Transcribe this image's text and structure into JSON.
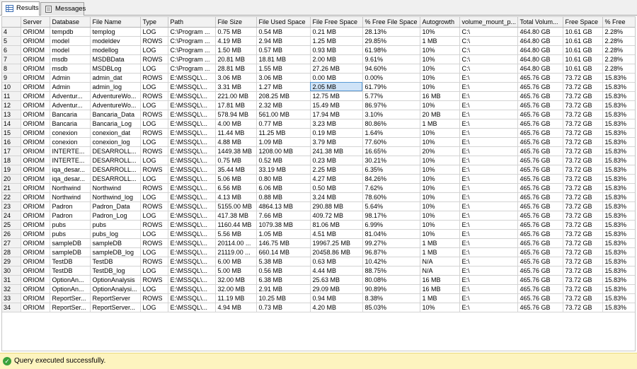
{
  "tabs": [
    {
      "label": "Results",
      "icon": "grid-icon"
    },
    {
      "label": "Messages",
      "icon": "document-icon"
    }
  ],
  "columns": [
    "",
    "Server",
    "Database",
    "File Name",
    "Type",
    "Path",
    "File Size",
    "File Used Space",
    "File Free Space",
    "% Free File Space",
    "Autogrowth",
    "volume_mount_p...",
    "Total Volum...",
    "Free Space",
    "% Free"
  ],
  "rows": [
    [
      "4",
      "ORIOM",
      "tempdb",
      "templog",
      "LOG",
      "C:\\Program ...",
      "0.75 MB",
      "0.54 MB",
      "0.21 MB",
      "28.13%",
      "10%",
      "C:\\",
      "464.80 GB",
      "10.61 GB",
      "2.28%"
    ],
    [
      "5",
      "ORIOM",
      "model",
      "modeldev",
      "ROWS",
      "C:\\Program ...",
      "4.19 MB",
      "2.94 MB",
      "1.25 MB",
      "29.85%",
      "1 MB",
      "C:\\",
      "464.80 GB",
      "10.61 GB",
      "2.28%"
    ],
    [
      "6",
      "ORIOM",
      "model",
      "modellog",
      "LOG",
      "C:\\Program ...",
      "1.50 MB",
      "0.57 MB",
      "0.93 MB",
      "61.98%",
      "10%",
      "C:\\",
      "464.80 GB",
      "10.61 GB",
      "2.28%"
    ],
    [
      "7",
      "ORIOM",
      "msdb",
      "MSDBData",
      "ROWS",
      "C:\\Program ...",
      "20.81 MB",
      "18.81 MB",
      "2.00 MB",
      "9.61%",
      "10%",
      "C:\\",
      "464.80 GB",
      "10.61 GB",
      "2.28%"
    ],
    [
      "8",
      "ORIOM",
      "msdb",
      "MSDBLog",
      "LOG",
      "C:\\Program ...",
      "28.81 MB",
      "1.55 MB",
      "27.26 MB",
      "94.60%",
      "10%",
      "C:\\",
      "464.80 GB",
      "10.61 GB",
      "2.28%"
    ],
    [
      "9",
      "ORIOM",
      "Admin",
      "admin_dat",
      "ROWS",
      "E:\\MSSQL\\...",
      "3.06 MB",
      "3.06 MB",
      "0.00 MB",
      "0.00%",
      "10%",
      "E:\\",
      "465.76 GB",
      "73.72 GB",
      "15.83%"
    ],
    [
      "10",
      "ORIOM",
      "Admin",
      "admin_log",
      "LOG",
      "E:\\MSSQL\\...",
      "3.31 MB",
      "1.27 MB",
      "2.05 MB",
      "61.79%",
      "10%",
      "E:\\",
      "465.76 GB",
      "73.72 GB",
      "15.83%"
    ],
    [
      "11",
      "ORIOM",
      "Adventur...",
      "AdventureWo...",
      "ROWS",
      "E:\\MSSQL\\...",
      "221.00 MB",
      "208.25 MB",
      "12.75 MB",
      "5.77%",
      "16 MB",
      "E:\\",
      "465.76 GB",
      "73.72 GB",
      "15.83%"
    ],
    [
      "12",
      "ORIOM",
      "Adventur...",
      "AdventureWo...",
      "LOG",
      "E:\\MSSQL\\...",
      "17.81 MB",
      "2.32 MB",
      "15.49 MB",
      "86.97%",
      "10%",
      "E:\\",
      "465.76 GB",
      "73.72 GB",
      "15.83%"
    ],
    [
      "13",
      "ORIOM",
      "Bancaria",
      "Bancaria_Data",
      "ROWS",
      "E:\\MSSQL\\...",
      "578.94 MB",
      "561.00 MB",
      "17.94 MB",
      "3.10%",
      "20 MB",
      "E:\\",
      "465.76 GB",
      "73.72 GB",
      "15.83%"
    ],
    [
      "14",
      "ORIOM",
      "Bancaria",
      "Bancaria_Log",
      "LOG",
      "E:\\MSSQL\\...",
      "4.00 MB",
      "0.77 MB",
      "3.23 MB",
      "80.86%",
      "1 MB",
      "E:\\",
      "465.76 GB",
      "73.72 GB",
      "15.83%"
    ],
    [
      "15",
      "ORIOM",
      "conexion",
      "conexion_dat",
      "ROWS",
      "E:\\MSSQL\\...",
      "11.44 MB",
      "11.25 MB",
      "0.19 MB",
      "1.64%",
      "10%",
      "E:\\",
      "465.76 GB",
      "73.72 GB",
      "15.83%"
    ],
    [
      "16",
      "ORIOM",
      "conexion",
      "conexion_log",
      "LOG",
      "E:\\MSSQL\\...",
      "4.88 MB",
      "1.09 MB",
      "3.79 MB",
      "77.60%",
      "10%",
      "E:\\",
      "465.76 GB",
      "73.72 GB",
      "15.83%"
    ],
    [
      "17",
      "ORIOM",
      "INTERTE...",
      "DESARROLL...",
      "ROWS",
      "E:\\MSSQL\\...",
      "1449.38 MB",
      "1208.00 MB",
      "241.38 MB",
      "16.65%",
      "20%",
      "E:\\",
      "465.76 GB",
      "73.72 GB",
      "15.83%"
    ],
    [
      "18",
      "ORIOM",
      "INTERTE...",
      "DESARROLL...",
      "LOG",
      "E:\\MSSQL\\...",
      "0.75 MB",
      "0.52 MB",
      "0.23 MB",
      "30.21%",
      "10%",
      "E:\\",
      "465.76 GB",
      "73.72 GB",
      "15.83%"
    ],
    [
      "19",
      "ORIOM",
      "iqa_desar...",
      "DESARROLL...",
      "ROWS",
      "E:\\MSSQL\\...",
      "35.44 MB",
      "33.19 MB",
      "2.25 MB",
      "6.35%",
      "10%",
      "E:\\",
      "465.76 GB",
      "73.72 GB",
      "15.83%"
    ],
    [
      "20",
      "ORIOM",
      "iqa_desar...",
      "DESARROLL...",
      "LOG",
      "E:\\MSSQL\\...",
      "5.06 MB",
      "0.80 MB",
      "4.27 MB",
      "84.26%",
      "10%",
      "E:\\",
      "465.76 GB",
      "73.72 GB",
      "15.83%"
    ],
    [
      "21",
      "ORIOM",
      "Northwind",
      "Northwind",
      "ROWS",
      "E:\\MSSQL\\...",
      "6.56 MB",
      "6.06 MB",
      "0.50 MB",
      "7.62%",
      "10%",
      "E:\\",
      "465.76 GB",
      "73.72 GB",
      "15.83%"
    ],
    [
      "22",
      "ORIOM",
      "Northwind",
      "Northwind_log",
      "LOG",
      "E:\\MSSQL\\...",
      "4.13 MB",
      "0.88 MB",
      "3.24 MB",
      "78.60%",
      "10%",
      "E:\\",
      "465.76 GB",
      "73.72 GB",
      "15.83%"
    ],
    [
      "23",
      "ORIOM",
      "Padron",
      "Padron_Data",
      "ROWS",
      "E:\\MSSQL\\...",
      "5155.00 MB",
      "4864.13 MB",
      "290.88 MB",
      "5.64%",
      "10%",
      "E:\\",
      "465.76 GB",
      "73.72 GB",
      "15.83%"
    ],
    [
      "24",
      "ORIOM",
      "Padron",
      "Padron_Log",
      "LOG",
      "E:\\MSSQL\\...",
      "417.38 MB",
      "7.66 MB",
      "409.72 MB",
      "98.17%",
      "10%",
      "E:\\",
      "465.76 GB",
      "73.72 GB",
      "15.83%"
    ],
    [
      "25",
      "ORIOM",
      "pubs",
      "pubs",
      "ROWS",
      "E:\\MSSQL\\...",
      "1160.44 MB",
      "1079.38 MB",
      "81.06 MB",
      "6.99%",
      "10%",
      "E:\\",
      "465.76 GB",
      "73.72 GB",
      "15.83%"
    ],
    [
      "26",
      "ORIOM",
      "pubs",
      "pubs_log",
      "LOG",
      "E:\\MSSQL\\...",
      "5.56 MB",
      "1.05 MB",
      "4.51 MB",
      "81.04%",
      "10%",
      "E:\\",
      "465.76 GB",
      "73.72 GB",
      "15.83%"
    ],
    [
      "27",
      "ORIOM",
      "sampleDB",
      "sampleDB",
      "ROWS",
      "E:\\MSSQL\\...",
      "20114.00 ...",
      "146.75 MB",
      "19967.25 MB",
      "99.27%",
      "1 MB",
      "E:\\",
      "465.76 GB",
      "73.72 GB",
      "15.83%"
    ],
    [
      "28",
      "ORIOM",
      "sampleDB",
      "sampleDB_log",
      "LOG",
      "E:\\MSSQL\\...",
      "21119.00 ...",
      "660.14 MB",
      "20458.86 MB",
      "96.87%",
      "1 MB",
      "E:\\",
      "465.76 GB",
      "73.72 GB",
      "15.83%"
    ],
    [
      "29",
      "ORIOM",
      "TestDB",
      "TestDB",
      "ROWS",
      "E:\\MSSQL\\...",
      "6.00 MB",
      "5.38 MB",
      "0.63 MB",
      "10.42%",
      "N/A",
      "E:\\",
      "465.76 GB",
      "73.72 GB",
      "15.83%"
    ],
    [
      "30",
      "ORIOM",
      "TestDB",
      "TestDB_log",
      "LOG",
      "E:\\MSSQL\\...",
      "5.00 MB",
      "0.56 MB",
      "4.44 MB",
      "88.75%",
      "N/A",
      "E:\\",
      "465.76 GB",
      "73.72 GB",
      "15.83%"
    ],
    [
      "31",
      "ORIOM",
      "OptionAn...",
      "OptionAnalysis",
      "ROWS",
      "E:\\MSSQL\\...",
      "32.00 MB",
      "6.38 MB",
      "25.63 MB",
      "80.08%",
      "16 MB",
      "E:\\",
      "465.76 GB",
      "73.72 GB",
      "15.83%"
    ],
    [
      "32",
      "ORIOM",
      "OptionAn...",
      "OptionAnalysi...",
      "LOG",
      "E:\\MSSQL\\...",
      "32.00 MB",
      "2.91 MB",
      "29.09 MB",
      "90.89%",
      "16 MB",
      "E:\\",
      "465.76 GB",
      "73.72 GB",
      "15.83%"
    ],
    [
      "33",
      "ORIOM",
      "ReportSer...",
      "ReportServer",
      "ROWS",
      "E:\\MSSQL\\...",
      "11.19 MB",
      "10.25 MB",
      "0.94 MB",
      "8.38%",
      "1 MB",
      "E:\\",
      "465.76 GB",
      "73.72 GB",
      "15.83%"
    ],
    [
      "34",
      "ORIOM",
      "ReportSer...",
      "ReportServer...",
      "LOG",
      "E:\\MSSQL\\...",
      "4.94 MB",
      "0.73 MB",
      "4.20 MB",
      "85.03%",
      "10%",
      "E:\\",
      "465.76 GB",
      "73.72 GB",
      "15.83%"
    ]
  ],
  "selected_cell": {
    "row": 6,
    "col": 8
  },
  "status": {
    "text": "Query executed successfully.",
    "icon": "check-circle-icon"
  },
  "colors": {
    "status_bg": "#fdf4bf",
    "selection": "#cfe3f7",
    "success": "#3aa23a"
  }
}
